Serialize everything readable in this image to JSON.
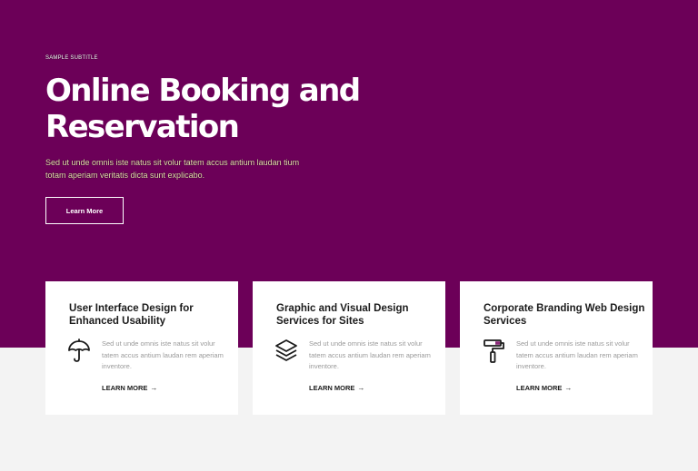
{
  "hero": {
    "subtitle": "SAMPLE SUBTITLE",
    "title": "Online Booking and Reservation",
    "description": "Sed ut unde omnis iste natus sit volur tatem accus antium laudan tium totam aperiam veritatis dicta sunt explicabo.",
    "button_label": "Learn More",
    "background_color": "#6c0058"
  },
  "services": [
    {
      "title": "User Interface Design for Enhanced Usability",
      "icon": "umbrella-icon",
      "text": "Sed ut unde omnis iste natus sit volur tatem accus antium laudan rem aperiam inventore.",
      "link_label": "LEARN MORE"
    },
    {
      "title": "Graphic and Visual Design Services for Sites",
      "icon": "layers-icon",
      "text": "Sed ut unde omnis iste natus sit volur tatem accus antium laudan rem aperiam inventore.",
      "link_label": "LEARN MORE"
    },
    {
      "title": "Corporate Branding Web Design Services",
      "icon": "paint-roller-icon",
      "text": "Sed ut unde omnis iste natus sit volur tatem accus antium laudan rem aperiam inventore.",
      "link_label": "LEARN MORE"
    }
  ]
}
